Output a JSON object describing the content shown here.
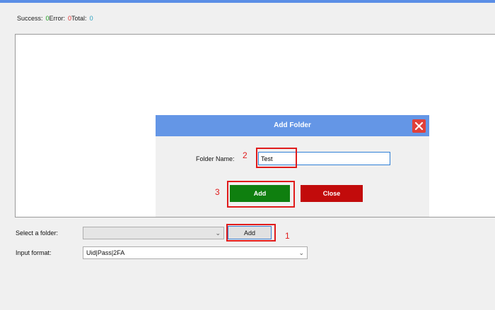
{
  "stats": {
    "success_label": "Success:",
    "success_value": "0",
    "error_label": "Error:",
    "error_value": "0",
    "total_label": "Total:",
    "total_value": "0"
  },
  "dialog": {
    "title": "Add Folder",
    "folder_name_label": "Folder Name:",
    "folder_name_value": "Test",
    "add_label": "Add",
    "close_label": "Close"
  },
  "form": {
    "select_folder_label": "Select a folder:",
    "select_folder_value": "",
    "add_button_label": "Add",
    "input_format_label": "Input format:",
    "input_format_value": "Uid|Pass|2FA"
  },
  "annotations": [
    "1",
    "2",
    "3"
  ],
  "colors": {
    "accent": "#6496e6",
    "add_green": "#0f7f0f",
    "close_red": "#c20b0b",
    "annotation_red": "#e01b1b"
  }
}
